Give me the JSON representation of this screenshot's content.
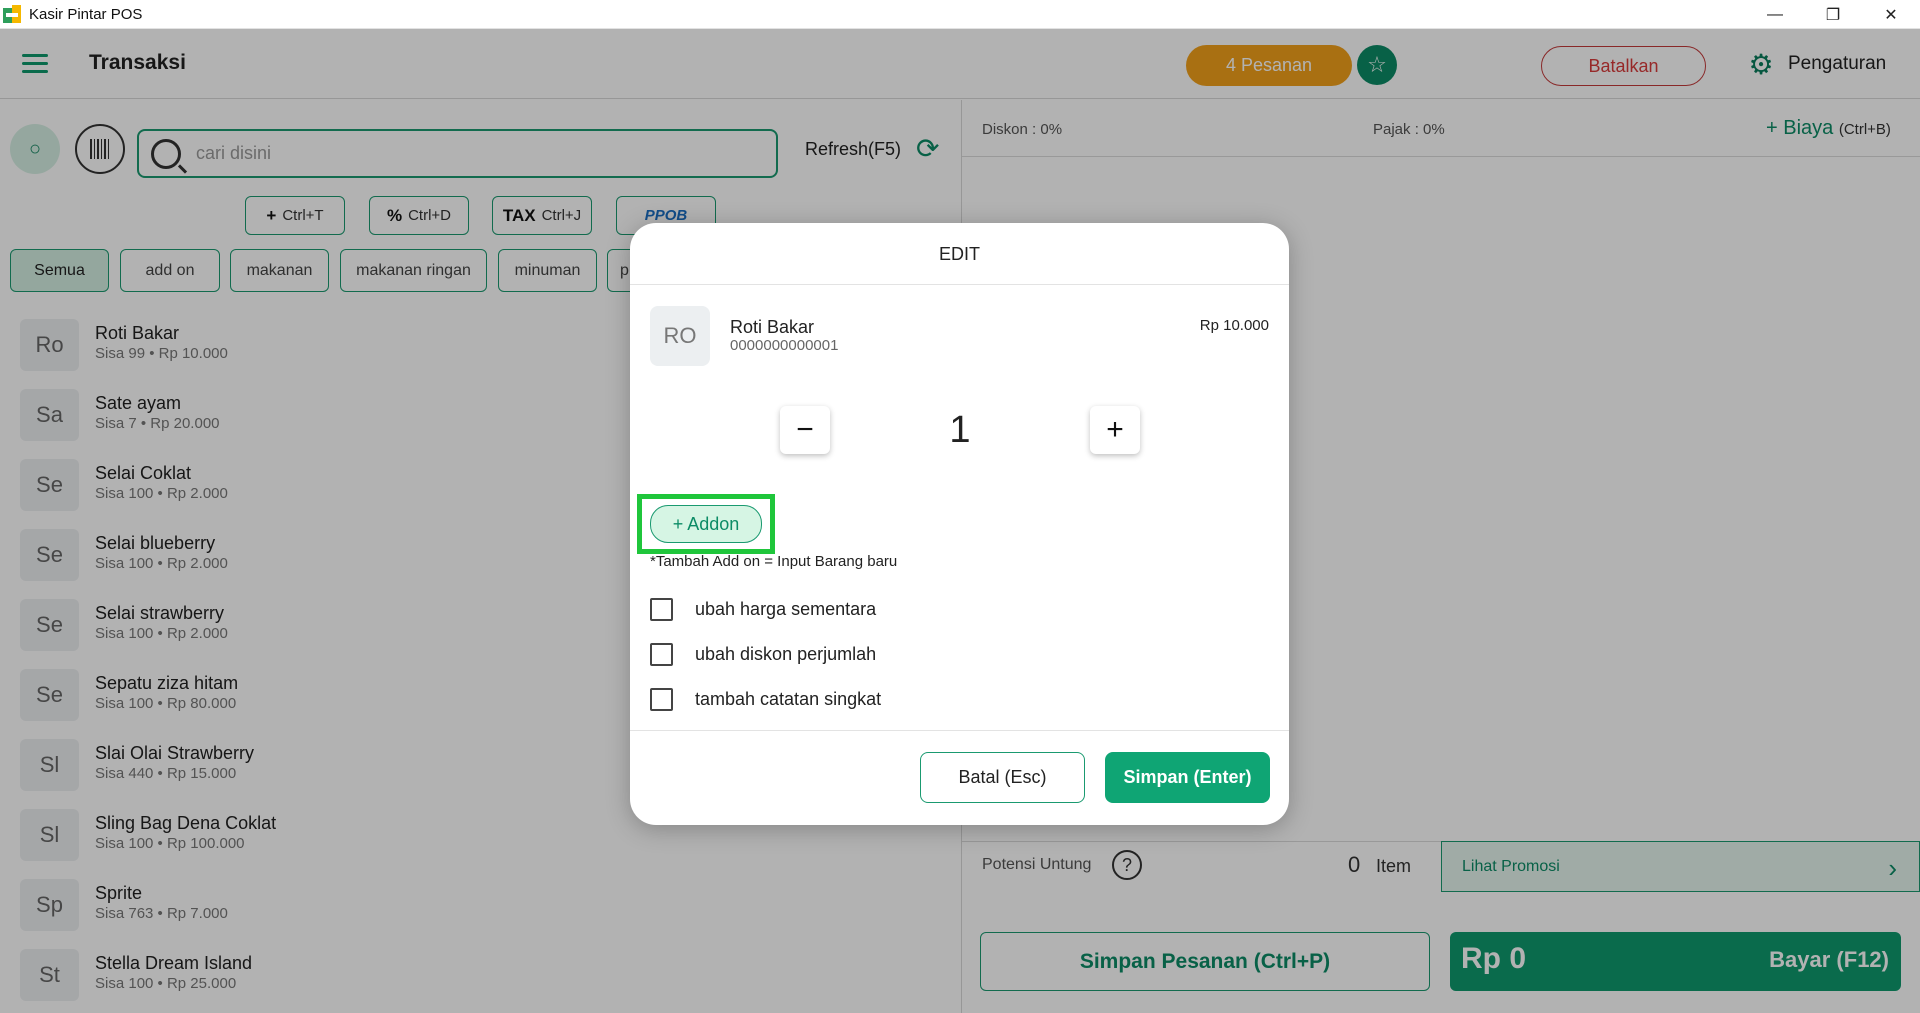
{
  "window": {
    "title": "Kasir Pintar POS",
    "minimize": "—",
    "restore": "❐",
    "close": "✕"
  },
  "topbar": {
    "title": "Transaksi",
    "orders": "4 Pesanan",
    "cancel": "Batalkan",
    "settings": "Pengaturan"
  },
  "search": {
    "placeholder": "cari disini",
    "refresh": "Refresh(F5)"
  },
  "shortcuts": [
    {
      "icon": "+",
      "label": "Ctrl+T"
    },
    {
      "icon": "%",
      "label": "Ctrl+D"
    },
    {
      "icon": "TAX",
      "label": "Ctrl+J"
    },
    {
      "icon": "",
      "label": "PPOB"
    }
  ],
  "categories": [
    "Semua",
    "add on",
    "makanan",
    "makanan ringan",
    "minuman",
    "p"
  ],
  "products": [
    {
      "initials": "Ro",
      "name": "Roti Bakar",
      "meta": "Sisa 99 • Rp 10.000"
    },
    {
      "initials": "Sa",
      "name": "Sate ayam",
      "meta": "Sisa 7 • Rp 20.000"
    },
    {
      "initials": "Se",
      "name": "Selai Coklat",
      "meta": "Sisa 100 • Rp 2.000"
    },
    {
      "initials": "Se",
      "name": "Selai blueberry",
      "meta": "Sisa 100 • Rp 2.000"
    },
    {
      "initials": "Se",
      "name": "Selai strawberry",
      "meta": "Sisa 100 • Rp 2.000"
    },
    {
      "initials": "Se",
      "name": "Sepatu ziza hitam",
      "meta": "Sisa 100 • Rp 80.000"
    },
    {
      "initials": "Sl",
      "name": "Slai Olai Strawberry",
      "meta": "Sisa 440 • Rp 15.000"
    },
    {
      "initials": "Sl",
      "name": "Sling Bag Dena Coklat",
      "meta": "Sisa 100 • Rp 100.000"
    },
    {
      "initials": "Sp",
      "name": "Sprite",
      "meta": "Sisa 763 • Rp 7.000"
    },
    {
      "initials": "St",
      "name": "Stella Dream Island",
      "meta": "Sisa 100 • Rp 25.000"
    }
  ],
  "cart": {
    "discount": "Diskon : 0%",
    "tax": "Pajak : 0%",
    "fee": "+ Biaya",
    "fee_shortcut": "(Ctrl+B)",
    "profit": "Potensi Untung",
    "item_count": "0",
    "item_label": "Item",
    "promo": "Lihat Promosi",
    "save_order": "Simpan Pesanan (Ctrl+P)",
    "total": "Rp 0",
    "pay": "Bayar (F12)"
  },
  "modal": {
    "title": "EDIT",
    "initials": "RO",
    "product_name": "Roti Bakar",
    "product_code": "0000000000001",
    "price": "Rp 10.000",
    "minus": "−",
    "plus": "+",
    "quantity": "1",
    "addon": "+ Addon",
    "addon_note": "*Tambah Add on = Input Barang baru",
    "options": [
      "ubah harga sementara",
      "ubah diskon perjumlah",
      "tambah catatan singkat"
    ],
    "cancel": "Batal (Esc)",
    "save": "Simpan (Enter)"
  },
  "colors": {
    "primary": "#0f9a6e",
    "orders": "#f2a11a",
    "danger": "#d93b3b",
    "highlight": "#1fc63b"
  }
}
